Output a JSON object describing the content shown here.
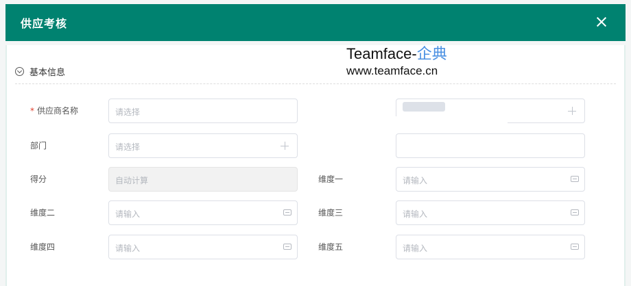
{
  "dialog": {
    "title": "供应考核"
  },
  "watermark": {
    "brand": "Teamface-",
    "brand_accent": "企典",
    "url": "www.teamface.cn"
  },
  "section": {
    "title": "基本信息"
  },
  "fields": {
    "supplier_name": {
      "label": "供应商名称",
      "placeholder": "请选择"
    },
    "department": {
      "label": "部门",
      "placeholder": "请选择"
    },
    "score": {
      "label": "得分",
      "placeholder": "自动计算"
    },
    "dim1": {
      "label": "维度一",
      "placeholder": "请输入"
    },
    "dim2": {
      "label": "维度二",
      "placeholder": "请输入"
    },
    "dim3": {
      "label": "维度三",
      "placeholder": "请输入"
    },
    "dim4": {
      "label": "维度四",
      "placeholder": "请输入"
    },
    "dim5": {
      "label": "维度五",
      "placeholder": "请输入"
    }
  },
  "colors": {
    "header": "#008270",
    "required": "#e03e2d"
  },
  "icons": [
    "close-icon",
    "collapse-icon",
    "plus-icon",
    "keyboard-icon"
  ]
}
